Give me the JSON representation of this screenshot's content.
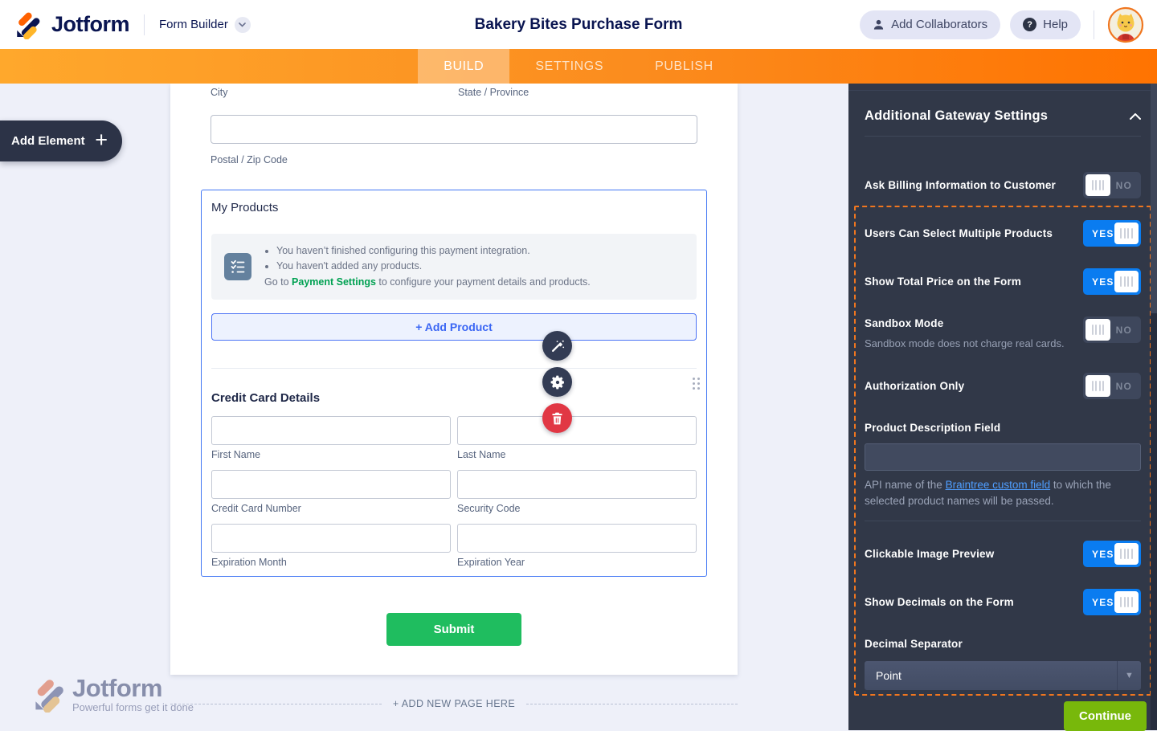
{
  "header": {
    "brand": "Jotform",
    "app_label": "Form Builder",
    "form_title": "Bakery Bites Purchase Form",
    "add_collaborators_label": "Add Collaborators",
    "help_label": "Help"
  },
  "nav": {
    "tabs": [
      {
        "label": "BUILD",
        "active": true
      },
      {
        "label": "SETTINGS",
        "active": false
      },
      {
        "label": "PUBLISH",
        "active": false
      }
    ]
  },
  "left_panel": {
    "add_element_label": "Add Element"
  },
  "form": {
    "address": {
      "city_label": "City",
      "state_label": "State / Province",
      "postal_label": "Postal / Zip Code"
    },
    "products": {
      "title": "My Products",
      "warnings": [
        "You haven’t finished configuring this payment integration.",
        "You haven't added any products."
      ],
      "goto_prefix": "Go to ",
      "goto_link": "Payment Settings",
      "goto_suffix": " to configure your payment details and products.",
      "add_product_label": "+ Add Product"
    },
    "credit_card": {
      "title": "Credit Card Details",
      "fields": [
        "First Name",
        "Last Name",
        "Credit Card Number",
        "Security Code",
        "Expiration Month",
        "Expiration Year"
      ]
    },
    "submit_label": "Submit"
  },
  "footer": {
    "watermark_brand": "Jotform",
    "watermark_tagline": "Powerful forms get it done",
    "add_page_label": "+ ADD NEW PAGE HERE"
  },
  "sidebar": {
    "title": "Additional Gateway Settings",
    "rows": {
      "billing": {
        "label": "Ask Billing Information to Customer",
        "value": "NO"
      },
      "multiple": {
        "label": "Users Can Select Multiple Products",
        "value": "YES"
      },
      "total": {
        "label": "Show Total Price on the Form",
        "value": "YES"
      },
      "sandbox": {
        "label": "Sandbox Mode",
        "value": "NO",
        "help": "Sandbox mode does not charge real cards."
      },
      "auth": {
        "label": "Authorization Only",
        "value": "NO"
      },
      "product_desc": {
        "label": "Product Description Field",
        "input_value": "",
        "help_prefix": "API name of the ",
        "help_link": "Braintree custom field",
        "help_suffix": " to which the selected product names will be passed."
      },
      "clickable": {
        "label": "Clickable Image Preview",
        "value": "YES"
      },
      "decimals": {
        "label": "Show Decimals on the Form",
        "value": "YES"
      },
      "separator": {
        "label": "Decimal Separator",
        "selected": "Point"
      }
    },
    "continue_label": "Continue"
  },
  "colors": {
    "brand_navy": "#0a1551",
    "accent_orange": "#ff7301",
    "toggle_on_blue": "#0a7cf0",
    "selection_blue": "#4277f4",
    "highlight_dashed_orange": "#f0761f",
    "submit_green": "#1fbd5f",
    "continue_green": "#78b80b",
    "payment_settings_green": "#00a152",
    "link_blue": "#4f9eff",
    "sidebar_bg": "#313848"
  }
}
